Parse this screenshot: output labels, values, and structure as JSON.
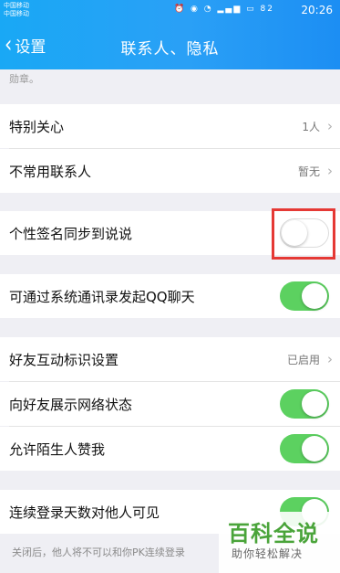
{
  "status_bar": {
    "carrier_1": "中国移动",
    "carrier_2": "中国移动",
    "icons": "⏰ ◉ ◔ ᵃᵃ ▂▄▆ ▭",
    "battery": "82",
    "time": "20:26"
  },
  "nav": {
    "back_label": "设置",
    "title": "联系人、隐私"
  },
  "top_note": "勋章。",
  "rows": {
    "special_care": {
      "label": "特别关心",
      "value": "1人"
    },
    "infrequent_contacts": {
      "label": "不常用联系人",
      "value": "暂无"
    },
    "signature_sync": {
      "label": "个性签名同步到说说",
      "toggle": false
    },
    "system_contacts_chat": {
      "label": "可通过系统通讯录发起QQ聊天",
      "toggle": true
    },
    "friend_interaction": {
      "label": "好友互动标识设置",
      "value": "已启用"
    },
    "network_status": {
      "label": "向好友展示网络状态",
      "toggle": true
    },
    "stranger_like": {
      "label": "允许陌生人赞我",
      "toggle": true
    },
    "login_days": {
      "label": "连续登录天数对他人可见",
      "toggle": true
    }
  },
  "footer_note": "关闭后，他人将不可以和你PK连续登录",
  "watermark": {
    "main": "百科全说",
    "sub": "助你轻松解决"
  },
  "colors": {
    "header_blue": "#1fa2f5",
    "toggle_on": "#5cd160",
    "highlight_red": "#e53935",
    "watermark_green": "#4aa43a"
  }
}
